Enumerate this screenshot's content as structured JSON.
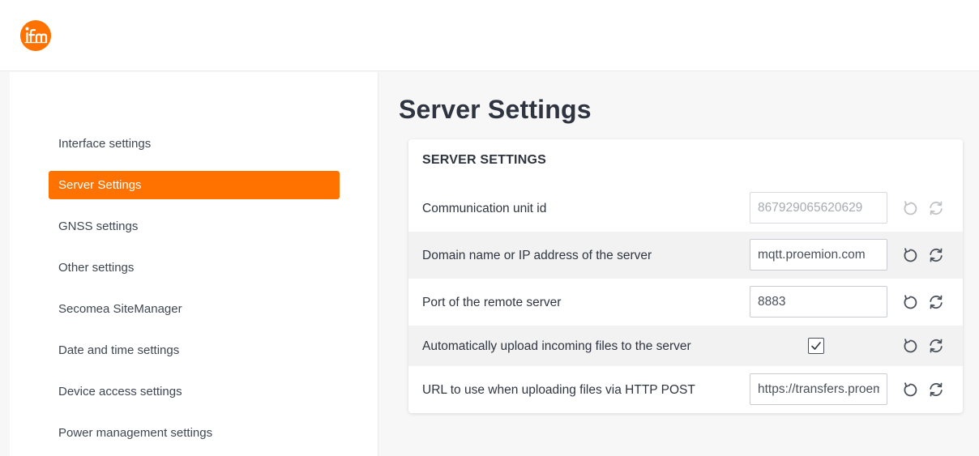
{
  "brand": {
    "logo_text": "ifm",
    "accent_color": "#ff7200"
  },
  "sidebar": {
    "items": [
      {
        "label": "Interface settings",
        "active": false
      },
      {
        "label": "Server Settings",
        "active": true
      },
      {
        "label": "GNSS settings",
        "active": false
      },
      {
        "label": "Other settings",
        "active": false
      },
      {
        "label": "Secomea SiteManager",
        "active": false
      },
      {
        "label": "Date and time settings",
        "active": false
      },
      {
        "label": "Device access settings",
        "active": false
      },
      {
        "label": "Power management settings",
        "active": false
      }
    ]
  },
  "page": {
    "title": "Server Settings"
  },
  "card": {
    "title": "SERVER SETTINGS",
    "rows": [
      {
        "label": "Communication unit id",
        "type": "text",
        "value": "867929065620629",
        "disabled": true
      },
      {
        "label": "Domain name or IP address of the server",
        "type": "text",
        "value": "mqtt.proemion.com",
        "disabled": false
      },
      {
        "label": "Port of the remote server",
        "type": "text",
        "value": "8883",
        "disabled": false
      },
      {
        "label": "Automatically upload incoming files to the server",
        "type": "checkbox",
        "checked": true,
        "disabled": false
      },
      {
        "label": "URL to use when uploading files via HTTP POST",
        "type": "text",
        "value": "https://transfers.proemion.com",
        "disabled": false
      }
    ],
    "row_icons": [
      "undo-icon",
      "reset-icon"
    ]
  }
}
